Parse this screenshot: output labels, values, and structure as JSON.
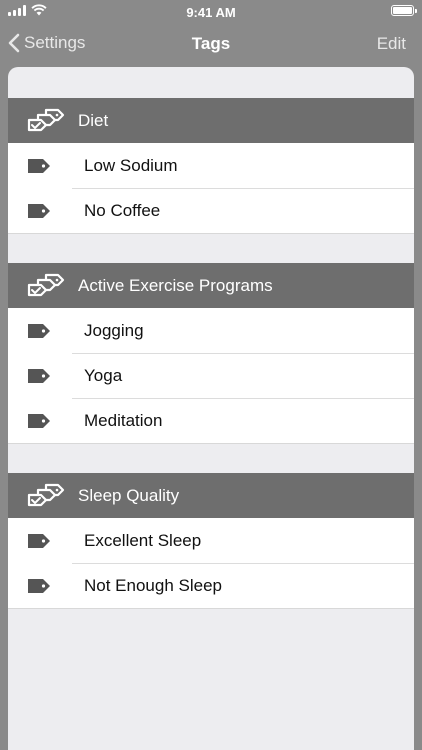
{
  "status_bar": {
    "time": "9:41 AM"
  },
  "nav": {
    "back_label": "Settings",
    "title": "Tags",
    "edit_label": "Edit"
  },
  "sections": [
    {
      "title": "Diet",
      "items": [
        {
          "label": "Low Sodium"
        },
        {
          "label": "No Coffee"
        }
      ]
    },
    {
      "title": "Active Exercise Programs",
      "items": [
        {
          "label": "Jogging"
        },
        {
          "label": "Yoga"
        },
        {
          "label": "Meditation"
        }
      ]
    },
    {
      "title": "Sleep Quality",
      "items": [
        {
          "label": "Excellent Sleep"
        },
        {
          "label": "Not Enough Sleep"
        }
      ]
    }
  ],
  "icons": {
    "section": "tags-group-icon",
    "row": "tag-icon",
    "back": "chevron-left-icon"
  },
  "colors": {
    "background": "#8a8a8a",
    "section_header": "#6e6e6e",
    "sheet": "#ededf0"
  }
}
